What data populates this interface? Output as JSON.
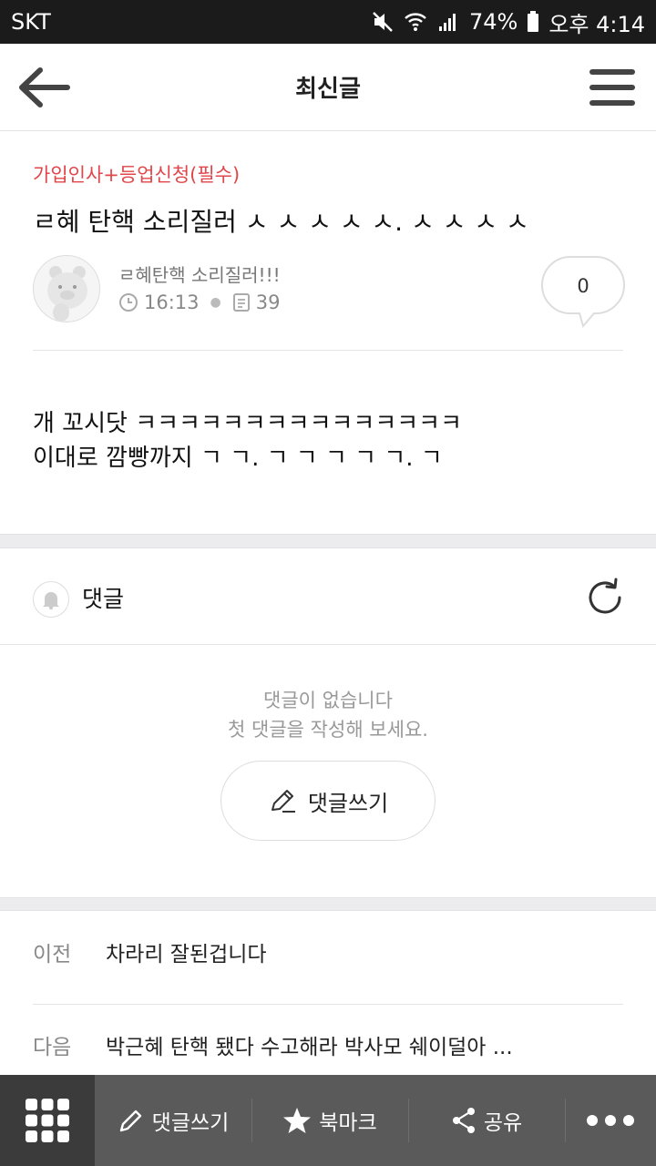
{
  "status_bar": {
    "carrier": "SKT",
    "battery": "74%",
    "time": "오후 4:14"
  },
  "header": {
    "title": "최신글"
  },
  "post": {
    "category": "가입인사+등업신청(필수)",
    "title": "ㄹ혜 탄핵 소리질러 ㅅ ㅅ ㅅ ㅅ ㅅ. ㅅ ㅅ ㅅ ㅅ",
    "author": "ㄹ혜탄핵 소리질러!!!",
    "time": "16:13",
    "views": "39",
    "comment_count": "0",
    "body_lines": [
      "개 꼬시닷 ㅋㅋㅋㅋㅋㅋㅋㅋㅋㅋㅋㅋㅋㅋㅋ",
      "이대로 깜빵까지 ㄱ ㄱ. ㄱ ㄱ ㄱ ㄱ ㄱ. ㄱ"
    ]
  },
  "comments": {
    "label": "댓글",
    "empty_line1": "댓글이 없습니다",
    "empty_line2": "첫 댓글을 작성해 보세요.",
    "write_button": "댓글쓰기"
  },
  "navigation": {
    "prev_label": "이전",
    "prev_title": "차라리 잘된겁니다",
    "next_label": "다음",
    "next_title": "박근혜 탄핵 됐다 수고해라 박사모 쉐이덜아 ..."
  },
  "toolbar": {
    "comment": "댓글쓰기",
    "bookmark": "북마크",
    "share": "공유"
  },
  "colors": {
    "accent_red": "#e0464a",
    "toolbar_bg": "#5a5a5a"
  }
}
